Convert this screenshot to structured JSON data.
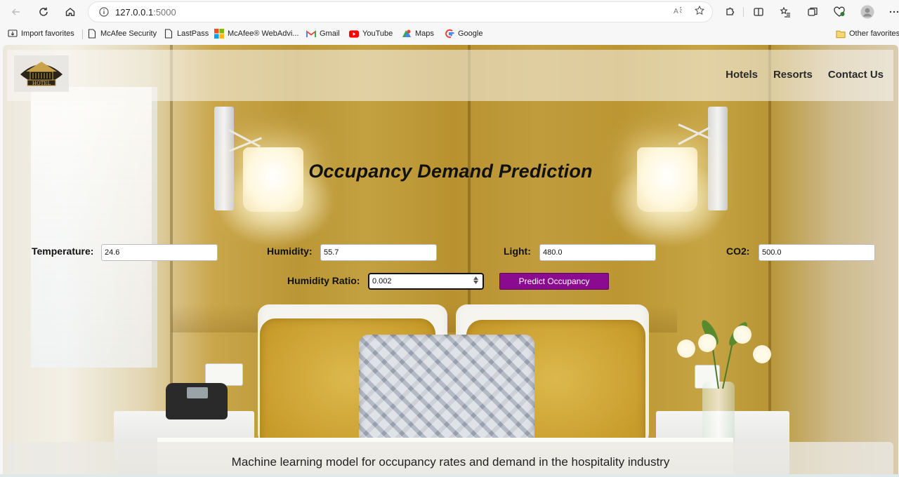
{
  "browser": {
    "url_host": "127.0.0.1",
    "url_port": ":5000",
    "bookmarks": [
      {
        "label": "Import favorites",
        "icon": "import-icon"
      },
      {
        "label": "McAfee Security",
        "icon": "page-icon"
      },
      {
        "label": "LastPass",
        "icon": "page-icon"
      },
      {
        "label": "McAfee® WebAdvi...",
        "icon": "windows-icon"
      },
      {
        "label": "Gmail",
        "icon": "gmail-icon"
      },
      {
        "label": "YouTube",
        "icon": "youtube-icon"
      },
      {
        "label": "Maps",
        "icon": "maps-icon"
      },
      {
        "label": "Google",
        "icon": "google-icon"
      }
    ],
    "other_favorites": "Other favorites"
  },
  "site": {
    "logo_text": "HOTEL",
    "nav": [
      "Hotels",
      "Resorts",
      "Contact Us"
    ]
  },
  "form": {
    "title": "Occupancy Demand Prediction",
    "fields": [
      {
        "label": "Temperature:",
        "value": "24.6"
      },
      {
        "label": "Humidity:",
        "value": "55.7"
      },
      {
        "label": "Light:",
        "value": "480.0"
      },
      {
        "label": "CO2:",
        "value": "500.0"
      },
      {
        "label": "Humidity Ratio:",
        "value": "0.002"
      }
    ],
    "submit": "Predict Occupancy"
  },
  "footer": {
    "text": "Machine learning model for occupancy rates and demand in the hospitality industry"
  },
  "colors": {
    "button": "#8a0b8f",
    "background_gold": "#c09c3d"
  }
}
